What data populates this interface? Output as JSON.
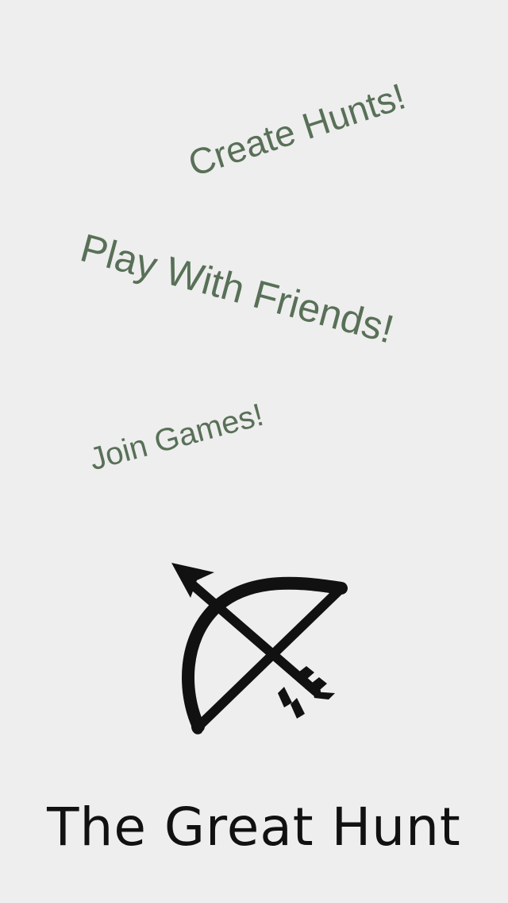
{
  "taglines": {
    "create": "Create Hunts!",
    "play": "Play With Friends!",
    "join": "Join Games!"
  },
  "logo": {
    "icon": "bow-and-arrow-icon"
  },
  "app_title": "The Great Hunt",
  "colors": {
    "background": "#eeeeee",
    "tagline": "#587057",
    "title": "#111111"
  }
}
